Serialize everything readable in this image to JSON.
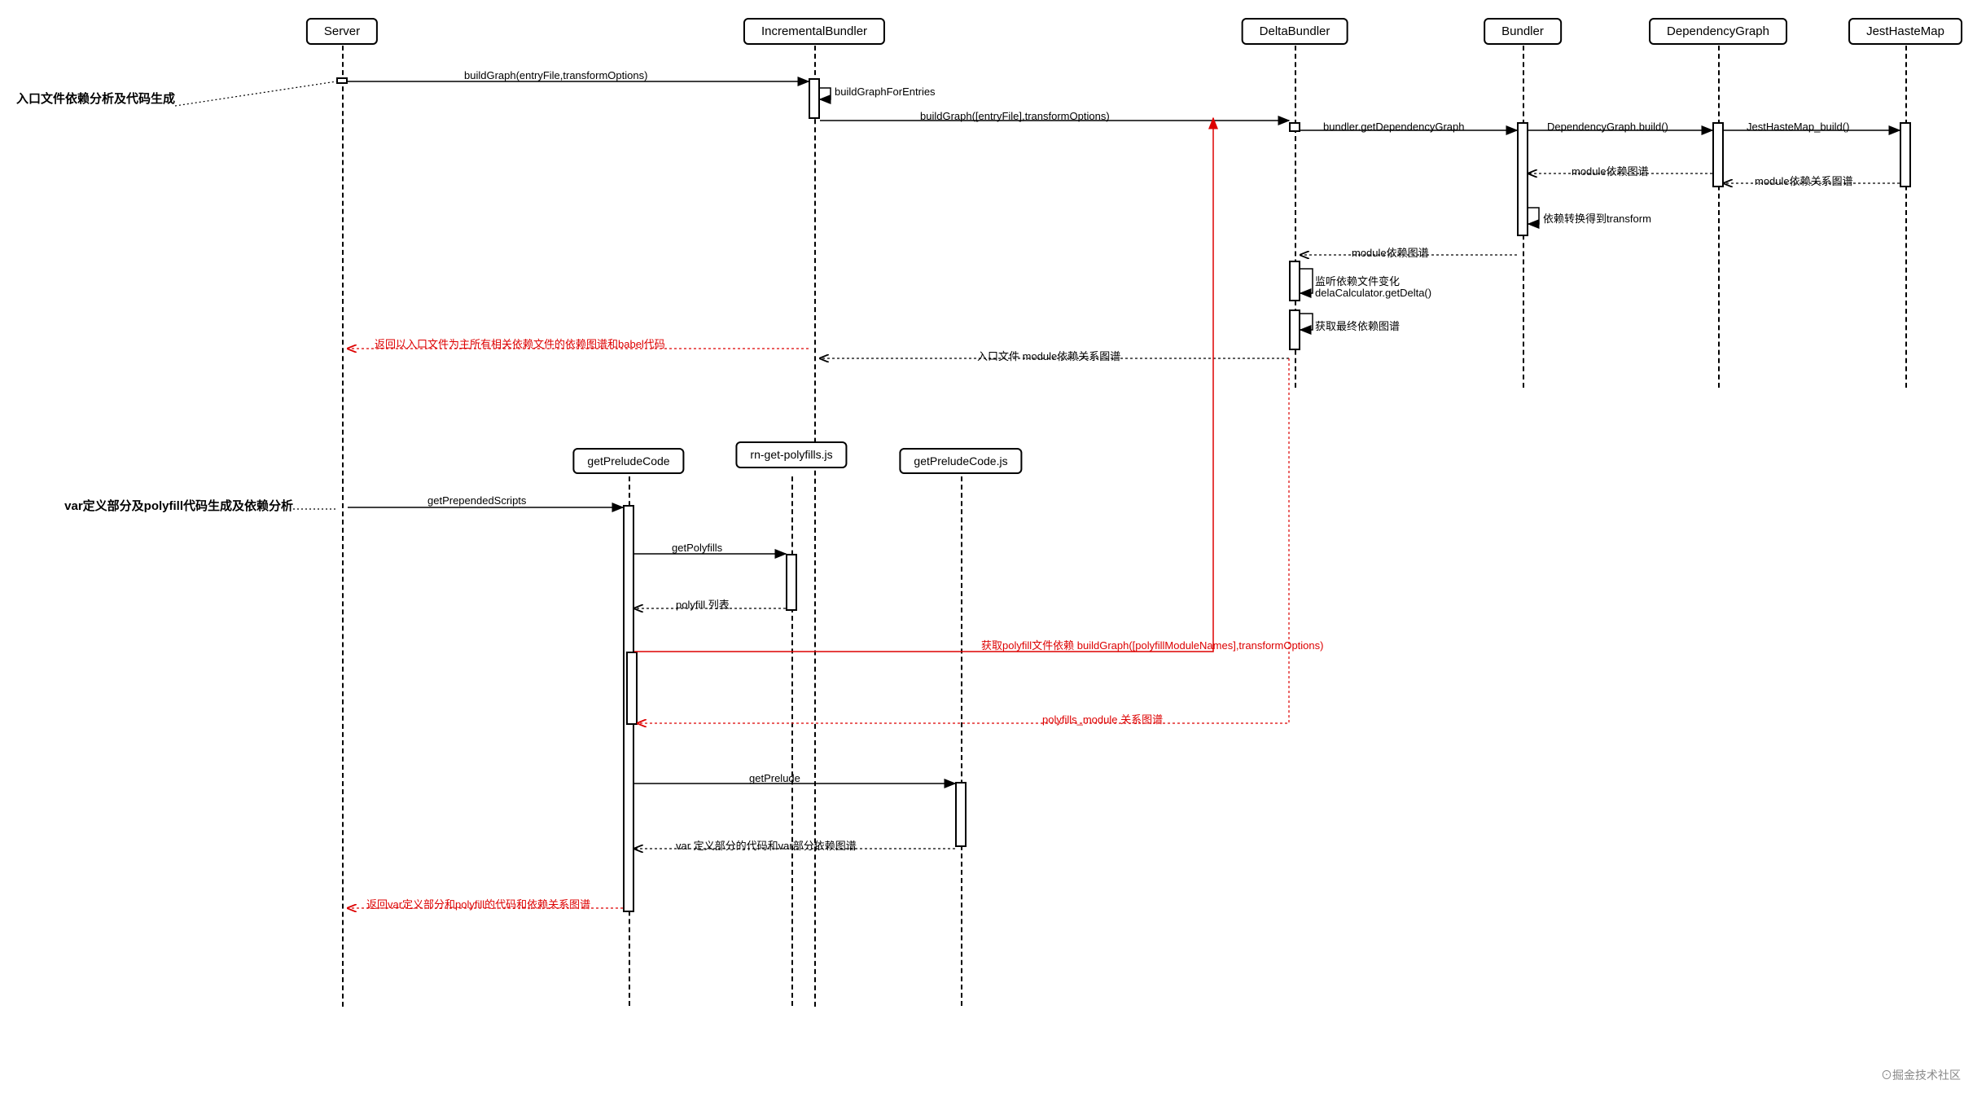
{
  "participants": {
    "server": "Server",
    "incrementalBundler": "IncrementalBundler",
    "deltaBundler": "DeltaBundler",
    "bundler": "Bundler",
    "dependencyGraph": "DependencyGraph",
    "jestHasteMap": "JestHasteMap"
  },
  "subParticipants": {
    "getPreludeCode": "getPreludeCode",
    "rnGetPolyfills": "rn-get-polyfills.js",
    "getPreludeCodeJs": "getPreludeCode.js"
  },
  "sideLabels": {
    "section1": "入口文件依赖分析及代码生成",
    "section2": "var定义部分及polyfill代码生成及依赖分析"
  },
  "messages": {
    "m1": "buildGraph(entryFile,transformOptions)",
    "m2": "buildGraphForEntries",
    "m3": "buildGraph([entryFile],transformOptions)",
    "m4": "bundler.getDependencyGraph",
    "m5": "DependencyGraph.build()",
    "m6": "JestHasteMap_build()",
    "m7": "module依赖图谱",
    "m8": "module依赖关系图谱",
    "m9": "依赖转换得到transform",
    "m10": "module依赖图谱",
    "m11": "监听依赖文件变化",
    "m12": "delaCalculator.getDelta()",
    "m13": "获取最终依赖图谱",
    "m14": "返回以入口文件为主所有相关依赖文件的依赖图谱和babel代码",
    "m15": "入口文件 module依赖关系图谱",
    "m16": "getPrependedScripts",
    "m17": "getPolyfills",
    "m18": "polyfill 列表",
    "m19": "获取polyfill文件依赖 buildGraph([polyfillModuleNames],transformOptions)",
    "m20": "polyfills_module 关系图谱",
    "m21": "getPrelude",
    "m22": "var 定义部分的代码和var部分依赖图谱",
    "m23": "返回var定义部分和polyfill的代码和依赖关系图谱"
  },
  "watermark": "⊙掘金技术社区",
  "chart_data": {
    "type": "sequence_diagram",
    "participants": [
      "Server",
      "IncrementalBundler",
      "DeltaBundler",
      "Bundler",
      "DependencyGraph",
      "JestHasteMap"
    ],
    "sub_participants": [
      "getPreludeCode",
      "rn-get-polyfills.js",
      "getPreludeCode.js"
    ],
    "sections": [
      {
        "label": "入口文件依赖分析及代码生成",
        "messages": [
          {
            "from": "Server",
            "to": "IncrementalBundler",
            "text": "buildGraph(entryFile,transformOptions)",
            "type": "solid"
          },
          {
            "from": "IncrementalBundler",
            "to": "IncrementalBundler",
            "text": "buildGraphForEntries",
            "type": "self"
          },
          {
            "from": "IncrementalBundler",
            "to": "DeltaBundler",
            "text": "buildGraph([entryFile],transformOptions)",
            "type": "solid"
          },
          {
            "from": "DeltaBundler",
            "to": "Bundler",
            "text": "bundler.getDependencyGraph",
            "type": "solid"
          },
          {
            "from": "Bundler",
            "to": "DependencyGraph",
            "text": "DependencyGraph.build()",
            "type": "solid"
          },
          {
            "from": "DependencyGraph",
            "to": "JestHasteMap",
            "text": "JestHasteMap_build()",
            "type": "solid"
          },
          {
            "from": "JestHasteMap",
            "to": "DependencyGraph",
            "text": "module依赖关系图谱",
            "type": "dashed"
          },
          {
            "from": "DependencyGraph",
            "to": "Bundler",
            "text": "module依赖图谱",
            "type": "dashed"
          },
          {
            "from": "Bundler",
            "to": "Bundler",
            "text": "依赖转换得到transform",
            "type": "self"
          },
          {
            "from": "Bundler",
            "to": "DeltaBundler",
            "text": "module依赖图谱",
            "type": "dashed"
          },
          {
            "from": "DeltaBundler",
            "to": "DeltaBundler",
            "text": "监听依赖文件变化 / delaCalculator.getDelta()",
            "type": "self"
          },
          {
            "from": "DeltaBundler",
            "to": "DeltaBundler",
            "text": "获取最终依赖图谱",
            "type": "self"
          },
          {
            "from": "DeltaBundler",
            "to": "IncrementalBundler",
            "text": "入口文件 module依赖关系图谱",
            "type": "dashed"
          },
          {
            "from": "IncrementalBundler",
            "to": "Server",
            "text": "返回以入口文件为主所有相关依赖文件的依赖图谱和babel代码",
            "type": "dashed",
            "color": "red"
          }
        ]
      },
      {
        "label": "var定义部分及polyfill代码生成及依赖分析",
        "messages": [
          {
            "from": "Server",
            "to": "getPreludeCode",
            "text": "getPrependedScripts",
            "type": "solid"
          },
          {
            "from": "getPreludeCode",
            "to": "rn-get-polyfills.js",
            "text": "getPolyfills",
            "type": "solid"
          },
          {
            "from": "rn-get-polyfills.js",
            "to": "getPreludeCode",
            "text": "polyfill 列表",
            "type": "dashed"
          },
          {
            "from": "getPreludeCode",
            "to": "DeltaBundler",
            "text": "获取polyfill文件依赖 buildGraph([polyfillModuleNames],transformOptions)",
            "type": "solid",
            "color": "red"
          },
          {
            "from": "DeltaBundler",
            "to": "getPreludeCode",
            "text": "polyfills_module 关系图谱",
            "type": "dashed",
            "color": "red"
          },
          {
            "from": "getPreludeCode",
            "to": "getPreludeCode.js",
            "text": "getPrelude",
            "type": "solid"
          },
          {
            "from": "getPreludeCode.js",
            "to": "getPreludeCode",
            "text": "var 定义部分的代码和var部分依赖图谱",
            "type": "dashed"
          },
          {
            "from": "getPreludeCode",
            "to": "Server",
            "text": "返回var定义部分和polyfill的代码和依赖关系图谱",
            "type": "dashed",
            "color": "red"
          }
        ]
      }
    ]
  },
  "positions": {
    "server": 420,
    "incrementalBundler": 1000,
    "deltaBundler": 1590,
    "bundler": 1870,
    "dependencyGraph": 2110,
    "jestHasteMap": 2340,
    "getPreludeCode": 772,
    "rnGetPolyfills": 972,
    "getPreludeCodeJs": 1180
  }
}
